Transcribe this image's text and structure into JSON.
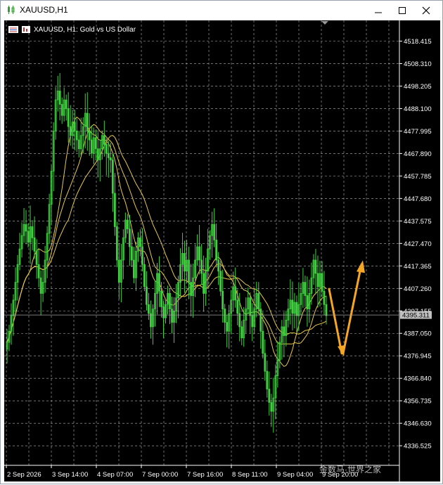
{
  "window": {
    "title": "XAUUSD,H1"
  },
  "chart": {
    "header_label": "XAUUSD, H1:  Gold vs US Dollar",
    "current_price_label": "4395.311",
    "current_price": 4395.311,
    "watermark": "金数马·世界之家",
    "colors": {
      "background": "#000000",
      "grid": "#b4b4b4",
      "candles": "#3fd03f",
      "moving_averages": "#e8c84a",
      "arrows": "#f5a623",
      "axis_text": "#ffffff",
      "price_label_bg": "#c0c0c0"
    }
  },
  "chart_data": {
    "type": "line",
    "symbol": "XAUUSD",
    "timeframe": "H1",
    "y_ticks": [
      4518.415,
      4508.31,
      4498.205,
      4488.1,
      4477.995,
      4467.89,
      4457.785,
      4447.68,
      4437.575,
      4427.47,
      4417.365,
      4407.26,
      4397.155,
      4387.05,
      4376.945,
      4366.84,
      4356.735,
      4346.63,
      4336.525
    ],
    "y_tick_labels": [
      "4518.415",
      "4508.310",
      "4498.205",
      "4488.100",
      "4477.995",
      "4467.890",
      "4457.785",
      "4447.680",
      "4437.575",
      "4427.470",
      "4417.365",
      "4407.260",
      "4397.155",
      "4387.050",
      "4376.945",
      "4366.840",
      "4356.735",
      "4346.630",
      "4336.525"
    ],
    "x_tick_labels": [
      "2 Sep 2026",
      "3 Sep 14:00",
      "4 Sep 07:00",
      "7 Sep 00:00",
      "7 Sep 16:00",
      "8 Sep 11:00",
      "9 Sep 04:00",
      "9 Sep 20:00"
    ],
    "ylim": [
      4331.0,
      4523.0
    ],
    "close_series": [
      4383,
      4388,
      4395,
      4402,
      4410,
      4418,
      4425,
      4431,
      4436,
      4433,
      4428,
      4435,
      4430,
      4424,
      4418,
      4412,
      4405,
      4410,
      4420,
      4432,
      4445,
      4460,
      4478,
      4492,
      4496,
      4490,
      4485,
      4492,
      4488,
      4480,
      4476,
      4482,
      4478,
      4474,
      4470,
      4476,
      4480,
      4486,
      4478,
      4474,
      4468,
      4475,
      4470,
      4465,
      4470,
      4476,
      4472,
      4468,
      4466,
      4465,
      4450,
      4435,
      4420,
      4410,
      4420,
      4430,
      4438,
      4434,
      4426,
      4420,
      4412,
      4424,
      4430,
      4426,
      4418,
      4408,
      4400,
      4396,
      4390,
      4398,
      4405,
      4414,
      4406,
      4399,
      4394,
      4400,
      4405,
      4398,
      4392,
      4397,
      4403,
      4410,
      4418,
      4423,
      4415,
      4420,
      4410,
      4404,
      4412,
      4420,
      4426,
      4420,
      4414,
      4405,
      4415,
      4425,
      4431,
      4436,
      4429,
      4420,
      4415,
      4406,
      4398,
      4392,
      4388,
      4396,
      4402,
      4408,
      4402,
      4396,
      4390,
      4385,
      4393,
      4398,
      4403,
      4395,
      4390,
      4398,
      4405,
      4398,
      4388,
      4378,
      4370,
      4362,
      4356,
      4352,
      4358,
      4368,
      4375,
      4383,
      4390,
      4386,
      4393,
      4398,
      4402,
      4396,
      4401,
      4395,
      4400,
      4405,
      4410,
      4404,
      4398,
      4405,
      4412,
      4420,
      4414,
      4408,
      4414,
      4406,
      4400,
      4395
    ],
    "projection": {
      "down_to": 4378,
      "then_up_to": 4418
    }
  }
}
